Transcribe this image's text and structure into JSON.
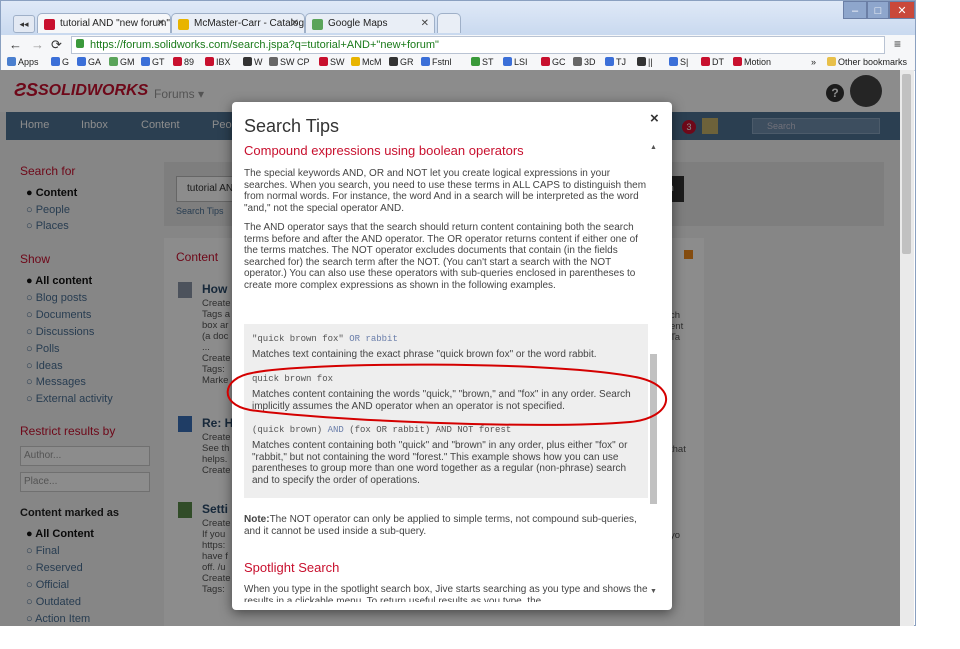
{
  "browser": {
    "tabs": [
      {
        "label": "tutorial AND \"new forum\"",
        "active": true,
        "color": "#c8102e"
      },
      {
        "label": "McMaster-Carr - Catalog",
        "active": false,
        "color": "#e8b400"
      },
      {
        "label": "Google Maps",
        "active": false,
        "color": "#5aa45a"
      }
    ],
    "url": "https://forum.solidworks.com/search.jspa?q=tutorial+AND+\"new+forum\"",
    "bookmarks": [
      {
        "label": "Apps",
        "color": "#4a7fcf"
      },
      {
        "label": "G",
        "color": "#3b6fd8"
      },
      {
        "label": "GA",
        "color": "#3b6fd8"
      },
      {
        "label": "GM",
        "color": "#5aa45a"
      },
      {
        "label": "GT",
        "color": "#3b6fd8"
      },
      {
        "label": "89",
        "color": "#c8102e"
      },
      {
        "label": "IBX",
        "color": "#c8102e"
      },
      {
        "label": "W",
        "color": "#333333"
      },
      {
        "label": "SW CP",
        "color": "#666666"
      },
      {
        "label": "SW",
        "color": "#c8102e"
      },
      {
        "label": "McM",
        "color": "#e8b400"
      },
      {
        "label": "GR",
        "color": "#333333"
      },
      {
        "label": "Fstnl",
        "color": "#3b6fd8"
      },
      {
        "label": "ST",
        "color": "#3a9a3a"
      },
      {
        "label": "LSI",
        "color": "#3b6fd8"
      },
      {
        "label": "GC",
        "color": "#c8102e"
      },
      {
        "label": "3D",
        "color": "#666666"
      },
      {
        "label": "TJ",
        "color": "#3b6fd8"
      },
      {
        "label": "||",
        "color": "#333333"
      },
      {
        "label": "S|",
        "color": "#3b6fd8"
      },
      {
        "label": "DT",
        "color": "#c8102e"
      },
      {
        "label": "Motion",
        "color": "#c8102e"
      }
    ],
    "other_bookmarks": "Other bookmarks"
  },
  "site": {
    "logo": "SOLIDWORKS",
    "forums": "Forums",
    "nav": [
      "Home",
      "Inbox",
      "Content",
      "Peo"
    ],
    "notif_count": "3",
    "search_placeholder": "Search",
    "search_value": "tutorial AN",
    "search_tips_link": "Search Tips",
    "search_btn": "h"
  },
  "sidebar": {
    "search_for_title": "Search for",
    "search_for": [
      {
        "label": "Content",
        "active": true
      },
      {
        "label": "People",
        "active": false
      },
      {
        "label": "Places",
        "active": false
      }
    ],
    "show_title": "Show",
    "show": [
      {
        "label": "All content",
        "active": true
      },
      {
        "label": "Blog posts",
        "active": false
      },
      {
        "label": "Documents",
        "active": false
      },
      {
        "label": "Discussions",
        "active": false
      },
      {
        "label": "Polls",
        "active": false
      },
      {
        "label": "Ideas",
        "active": false
      },
      {
        "label": "Messages",
        "active": false
      },
      {
        "label": "External activity",
        "active": false
      }
    ],
    "restrict_title": "Restrict results by",
    "author_placeholder": "Author...",
    "place_placeholder": "Place...",
    "marked_title": "Content marked as",
    "marked": [
      {
        "label": "All Content",
        "active": true
      },
      {
        "label": "Final",
        "active": false
      },
      {
        "label": "Reserved",
        "active": false
      },
      {
        "label": "Official",
        "active": false
      },
      {
        "label": "Outdated",
        "active": false
      },
      {
        "label": "Action Item",
        "active": false
      }
    ]
  },
  "results": {
    "heading": "Content",
    "items": [
      {
        "title": "How",
        "lines": [
          "Create",
          "Tags a",
          "box ar",
          "(a doc",
          "...",
          "Create",
          "Tags:",
          "Marke"
        ],
        "right": [
          "ch",
          "ent",
          "Ta"
        ]
      },
      {
        "title": "Re: H",
        "lines": [
          "Create",
          "See th",
          "helps.",
          "Create"
        ],
        "right": [
          "that"
        ]
      },
      {
        "title": "Setti",
        "lines": [
          "Create",
          "If you",
          "https:",
          "have f",
          "off. /u",
          "Create",
          "Tags:"
        ],
        "right": [
          "yo"
        ]
      }
    ]
  },
  "modal": {
    "title": "Search Tips",
    "close": "×",
    "h1": "Compound expressions using boolean operators",
    "p1": "The special keywords AND, OR and NOT let you create logical expressions in your searches. When you search, you need to use these terms in ALL CAPS to distinguish them from normal words. For instance, the word And in a search will be interpreted as the word \"and,\" not the special operator AND.",
    "p2": "The AND operator says that the search should return content containing both the search terms before and after the AND operator. The OR operator returns content if either one of the terms matches. The NOT operator excludes documents that contain (in the fields searched for) the search term after the NOT. (You can't start a search with the NOT operator.) You can also use these operators with sub-queries enclosed in parentheses to create more complex expressions as shown in the following examples.",
    "examples": [
      {
        "code": "\"quick brown fox\"",
        "op": " OR ",
        "code2": "rabbit",
        "desc": "Matches text containing the exact phrase \"quick brown fox\" or the word rabbit."
      },
      {
        "code": "quick brown fox",
        "op": "",
        "code2": "",
        "desc": "Matches content containing the words \"quick,\" \"brown,\" and \"fox\" in any order. Search implicitly assumes the AND operator when an operator is not specified."
      },
      {
        "code": "(quick brown)",
        "op": " AND ",
        "code2": "(fox OR rabbit) AND NOT forest",
        "desc": "Matches content containing both \"quick\" and \"brown\" in any order, plus either \"fox\" or \"rabbit,\" but not containing the word \"forest.\" This example shows how you can use parentheses to group more than one word together as a regular (non-phrase) search and to specify the order of operations."
      }
    ],
    "note_label": "Note:",
    "note": "The NOT operator can only be applied to simple terms, not compound sub-queries, and it cannot be used inside a sub-query.",
    "h2": "Spotlight Search",
    "p3": "When you type in the spotlight search box, Jive starts searching as you type and shows the results in a clickable menu. To return useful results as you type, the"
  },
  "colors": {
    "accent": "#c8102e",
    "nav": "#4f7394",
    "link": "#4a6f94",
    "annotation": "#d40000"
  }
}
